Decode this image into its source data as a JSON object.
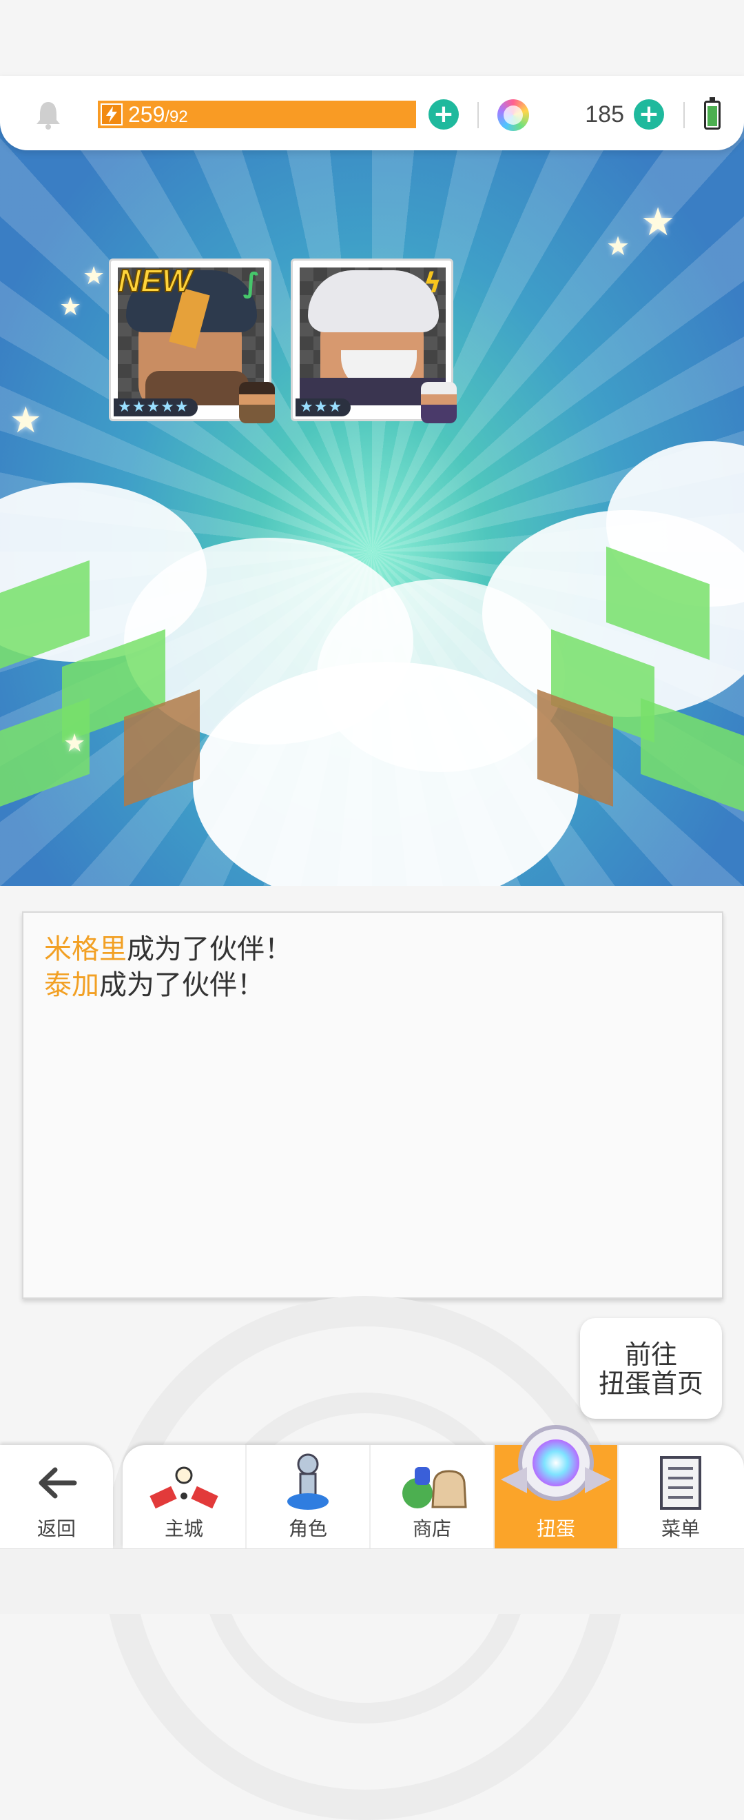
{
  "header": {
    "stamina_current": "259",
    "stamina_max": "/92",
    "gem_count": "185",
    "battery_level": 0.8
  },
  "cards": [
    {
      "badge": "NEW",
      "element": "leaf",
      "rarity_stars": "★★★★★",
      "stars": 5
    },
    {
      "badge": "",
      "element": "lightning",
      "rarity_stars": "★★★",
      "stars": 3
    }
  ],
  "messages": [
    {
      "name": "米格里",
      "text": "成为了伙伴！"
    },
    {
      "name": "泰加",
      "text": "成为了伙伴！"
    }
  ],
  "goto_button": {
    "line1": "前往",
    "line2": "扭蛋首页"
  },
  "nav": {
    "back": "返回",
    "tabs": [
      "主城",
      "角色",
      "商店",
      "扭蛋",
      "菜单"
    ],
    "active_tab": "扭蛋"
  },
  "colors": {
    "stamina": "#f99b24",
    "plus": "#1fb99d",
    "name_highlight": "#f2a024",
    "active_tab": "#fba429"
  }
}
